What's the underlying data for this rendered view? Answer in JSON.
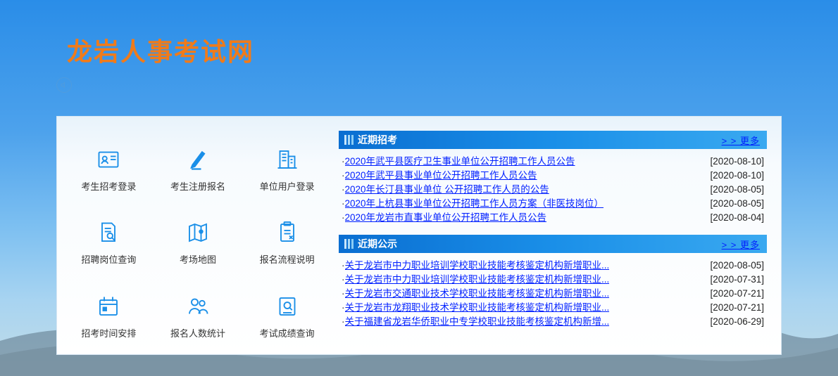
{
  "site": {
    "title": "龙岩人事考试网"
  },
  "grid": [
    {
      "label": "考生招考登录"
    },
    {
      "label": "考生注册报名"
    },
    {
      "label": "单位用户登录"
    },
    {
      "label": "招聘岗位查询"
    },
    {
      "label": "考场地图"
    },
    {
      "label": "报名流程说明"
    },
    {
      "label": "招考时间安排"
    },
    {
      "label": "报名人数统计"
    },
    {
      "label": "考试成绩查询"
    }
  ],
  "panels": {
    "recruit": {
      "title": "近期招考",
      "more": "> > 更多",
      "items": [
        {
          "title": "2020年武平县医疗卫生事业单位公开招聘工作人员公告",
          "date": "[2020-08-10]"
        },
        {
          "title": "2020年武平县事业单位公开招聘工作人员公告",
          "date": "[2020-08-10]"
        },
        {
          "title": "2020年长汀县事业单位 公开招聘工作人员的公告",
          "date": "[2020-08-05]"
        },
        {
          "title": "2020年上杭县事业单位公开招聘工作人员方案（非医技岗位）",
          "date": "[2020-08-05]"
        },
        {
          "title": "2020年龙岩市直事业单位公开招聘工作人员公告",
          "date": "[2020-08-04]"
        }
      ]
    },
    "notice": {
      "title": "近期公示",
      "more": "> > 更多",
      "items": [
        {
          "title": "关于龙岩市中力职业培训学校职业技能考核鉴定机构新增职业...",
          "date": "[2020-08-05]"
        },
        {
          "title": "关于龙岩市中力职业培训学校职业技能考核鉴定机构新增职业...",
          "date": "[2020-07-31]"
        },
        {
          "title": "关于龙岩市交通职业技术学校职业技能考核鉴定机构新增职业...",
          "date": "[2020-07-21]"
        },
        {
          "title": "关于龙岩市龙翔职业技术学校职业技能考核鉴定机构新增职业...",
          "date": "[2020-07-21]"
        },
        {
          "title": "关于福建省龙岩华侨职业中专学校职业技能考核鉴定机构新增...",
          "date": "[2020-06-29]"
        }
      ]
    }
  }
}
